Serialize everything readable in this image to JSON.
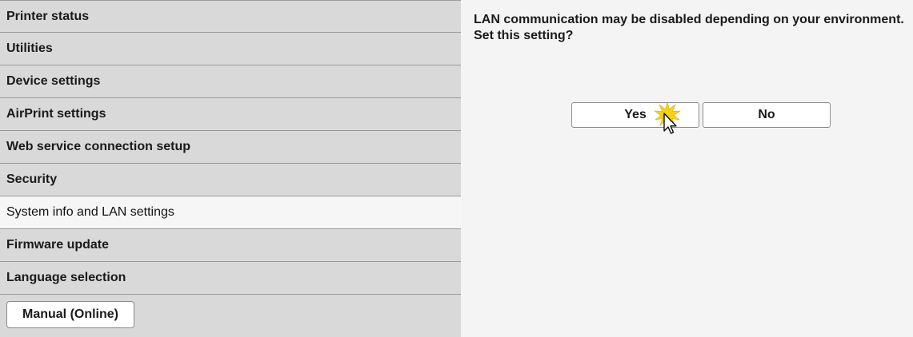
{
  "sidebar": {
    "items": [
      {
        "label": "Printer status"
      },
      {
        "label": "Utilities"
      },
      {
        "label": "Device settings"
      },
      {
        "label": "AirPrint settings"
      },
      {
        "label": "Web service connection setup"
      },
      {
        "label": "Security"
      },
      {
        "label": "System info and LAN settings",
        "selected": true
      },
      {
        "label": "Firmware update"
      },
      {
        "label": "Language selection"
      }
    ],
    "manual_button": "Manual (Online)"
  },
  "main": {
    "message_line1": "LAN communication may be disabled depending on your environment.",
    "message_line2": "Set this setting?",
    "yes_label": "Yes",
    "no_label": "No"
  },
  "colors": {
    "sidebar_bg": "#d9d9d9",
    "selected_bg": "#f6f6f6",
    "main_bg": "#f4f4f4",
    "click_highlight": "#f7d117"
  },
  "icons": {
    "cursor": "pointer-cursor-icon"
  }
}
